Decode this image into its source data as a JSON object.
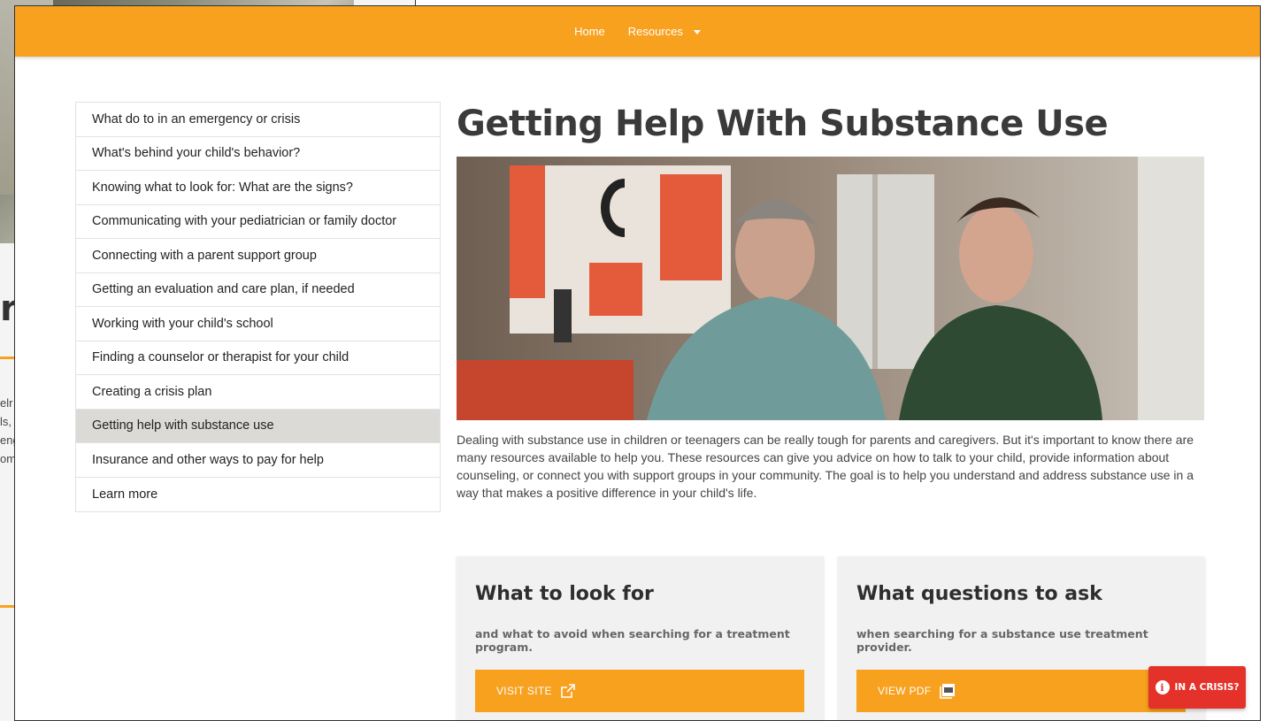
{
  "background_window": {
    "heading_fragment": "re",
    "text_fragments": [
      "elr",
      "ls,",
      "eng",
      "om"
    ]
  },
  "nav": {
    "home_label": "Home",
    "resources_label": "Resources"
  },
  "side_menu": {
    "items": [
      {
        "label": "What do to in an emergency or crisis"
      },
      {
        "label": "What's behind your child's behavior?"
      },
      {
        "label": "Knowing what to look for: What are the signs?"
      },
      {
        "label": "Communicating with your pediatrician or family doctor"
      },
      {
        "label": "Connecting with a parent support group"
      },
      {
        "label": "Getting an evaluation and care plan, if needed"
      },
      {
        "label": "Working with your child's school"
      },
      {
        "label": "Finding a counselor or therapist for your child"
      },
      {
        "label": "Creating a crisis plan"
      },
      {
        "label": "Getting help with substance use",
        "active": true
      },
      {
        "label": "Insurance and other ways to pay for help"
      },
      {
        "label": "Learn more"
      }
    ]
  },
  "main": {
    "title": "Getting Help With Substance Use",
    "intro": "Dealing with substance use in children or teenagers can be really tough for parents and caregivers. But it's important to know there are many resources available to help you. These resources can give you advice on how to talk to your child, provide information about counseling, or connect you with support groups in your community. The goal is to help you understand and address substance use in a way that makes a positive difference in your child's life."
  },
  "cards": [
    {
      "title": "What to look for",
      "subtitle": "and what to avoid when searching for a treatment program.",
      "button_label": "VISIT SITE",
      "button_icon": "external-link-icon"
    },
    {
      "title": "What questions to ask",
      "subtitle": "when searching for a substance use treatment provider.",
      "button_label": "VIEW PDF",
      "button_icon": "pdf-icon"
    }
  ],
  "crisis_button": {
    "label": "IN A CRISIS?",
    "icon": "info-icon"
  },
  "colors": {
    "accent": "#f8a11f",
    "crisis": "#e4312a",
    "active_menu": "#dcdad7"
  }
}
